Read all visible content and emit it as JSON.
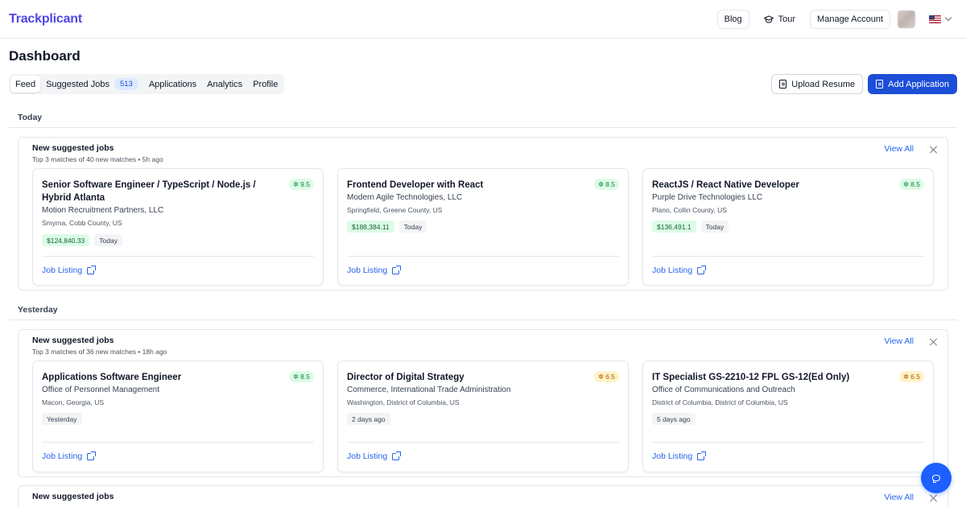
{
  "brand": "Trackplicant",
  "nav": {
    "blog": "Blog",
    "tour": "Tour",
    "manage_account": "Manage Account"
  },
  "page_title": "Dashboard",
  "tabs": [
    {
      "label": "Feed",
      "active": true
    },
    {
      "label": "Suggested Jobs",
      "badge": "513"
    },
    {
      "label": "Applications"
    },
    {
      "label": "Analytics"
    },
    {
      "label": "Profile"
    }
  ],
  "actions": {
    "upload_resume": "Upload Resume",
    "add_application": "Add Application"
  },
  "colors": {
    "brand": "#4f46e5",
    "primary": "#1d4ed8",
    "link": "#2563eb",
    "score_green_bg": "#dcfce7",
    "score_yellow_bg": "#fef3c7"
  },
  "sections": [
    {
      "day": "Today",
      "group_title": "New suggested jobs",
      "group_sub": "Top 3 matches of 40 new matches • 5h ago",
      "view_all": "View All",
      "jobs": [
        {
          "title": "Senior Software Engineer / TypeScript / Node.js / Hybrid Atlanta",
          "score": "9.5",
          "score_level": "green",
          "company": "Motion Recruitment Partners, LLC",
          "location": "Smyrna, Cobb County, US",
          "salary": "$124,840.33",
          "posted": "Today",
          "link": "Job Listing"
        },
        {
          "title": "Frontend Developer with React",
          "score": "8.5",
          "score_level": "green",
          "company": "Modern Agile Technologies, LLC",
          "location": "Springfield, Greene County, US",
          "salary": "$188,384.11",
          "posted": "Today",
          "link": "Job Listing"
        },
        {
          "title": "ReactJS / React Native Developer",
          "score": "8.5",
          "score_level": "green",
          "company": "Purple Drive Technologies LLC",
          "location": "Plano, Collin County, US",
          "salary": "$136,491.1",
          "posted": "Today",
          "link": "Job Listing"
        }
      ]
    },
    {
      "day": "Yesterday",
      "group_title": "New suggested jobs",
      "group_sub": "Top 3 matches of 36 new matches • 18h ago",
      "view_all": "View All",
      "jobs": [
        {
          "title": "Applications Software Engineer",
          "score": "8.5",
          "score_level": "green",
          "company": "Office of Personnel Management",
          "location": "Macon, Georgia, US",
          "posted": "Yesterday",
          "link": "Job Listing"
        },
        {
          "title": "Director of Digital Strategy",
          "score": "6.5",
          "score_level": "yellow",
          "company": "Commerce, International Trade Administration",
          "location": "Washington, District of Columbia, US",
          "posted": "2 days ago",
          "link": "Job Listing"
        },
        {
          "title": "IT Specialist GS-2210-12 FPL GS-12(Ed Only)",
          "score": "6.5",
          "score_level": "yellow",
          "company": "Office of Communications and Outreach",
          "location": "District of Columbia, District of Columbia, US",
          "posted": "5 days ago",
          "link": "Job Listing"
        }
      ]
    },
    {
      "group_title": "New suggested jobs",
      "view_all": "View All"
    }
  ],
  "icons": [
    "graduation-cap-icon",
    "user-avatar",
    "us-flag-icon",
    "chevron-down-icon",
    "document-icon",
    "document-plus-icon",
    "sparkle-icon",
    "external-link-icon",
    "close-icon",
    "chat-icon"
  ]
}
